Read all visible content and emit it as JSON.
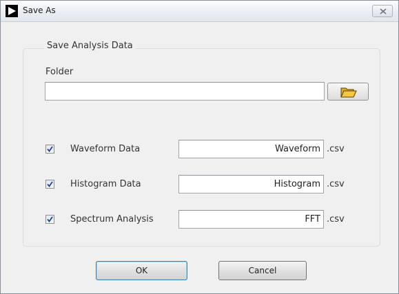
{
  "window": {
    "title": "Save As"
  },
  "group": {
    "title": "Save Analysis Data"
  },
  "folder": {
    "label": "Folder",
    "value": "",
    "browse_icon": "folder-open-icon"
  },
  "rows": [
    {
      "label": "Waveform Data",
      "checked": true,
      "filename": "Waveform",
      "ext": ".csv"
    },
    {
      "label": "Histogram Data",
      "checked": true,
      "filename": "Histogram",
      "ext": ".csv"
    },
    {
      "label": "Spectrum Analysis",
      "checked": true,
      "filename": "FFT",
      "ext": ".csv"
    }
  ],
  "buttons": {
    "ok": "OK",
    "cancel": "Cancel"
  },
  "colors": {
    "check_mark": "#1f3f9a",
    "folder_fill": "#f3c840",
    "default_button_border": "#3c7fb1"
  }
}
